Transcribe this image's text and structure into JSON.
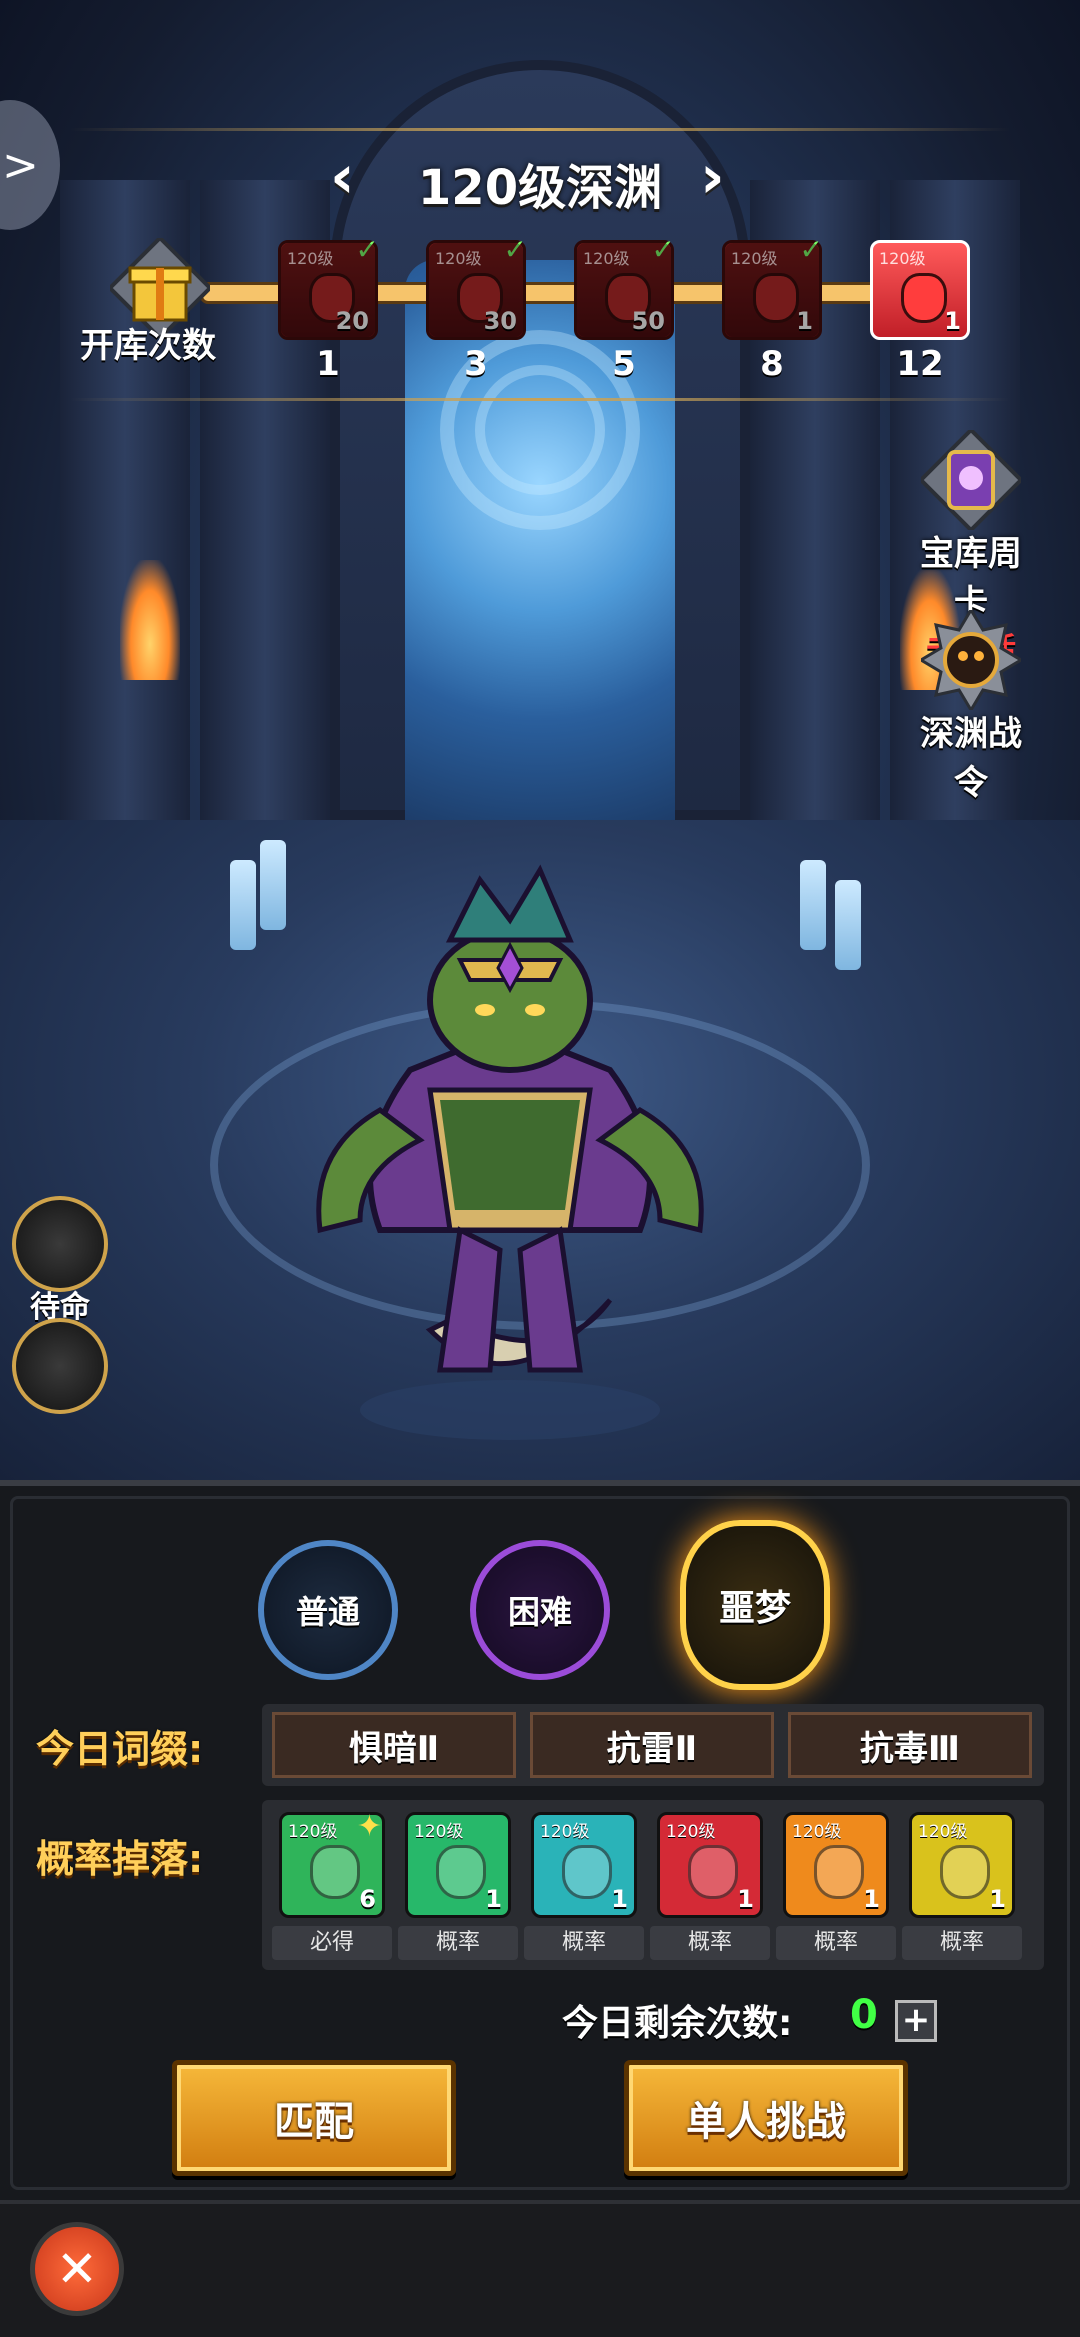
{
  "header": {
    "level_title": "120级深渊",
    "prev_arrow": "‹",
    "next_arrow": "›",
    "left_tab_arrow": ">"
  },
  "progress": {
    "label": "开库次数",
    "milestones": [
      {
        "tag": "120级",
        "count": "20",
        "step": "1",
        "claimed": true
      },
      {
        "tag": "120级",
        "count": "30",
        "step": "3",
        "claimed": true
      },
      {
        "tag": "120级",
        "count": "50",
        "step": "5",
        "claimed": true
      },
      {
        "tag": "120级",
        "count": "1",
        "step": "8",
        "claimed": true
      },
      {
        "tag": "120级",
        "count": "1",
        "step": "12",
        "claimed": false
      }
    ]
  },
  "right_buttons": {
    "weekly_card": {
      "label": "宝库周卡",
      "status": "未激活"
    },
    "battle_pass": {
      "label": "深渊战令"
    }
  },
  "left_buttons": {
    "standby": {
      "label": "待命"
    }
  },
  "difficulty": {
    "normal": "普通",
    "hard": "困难",
    "nightmare": "噩梦"
  },
  "affixes": {
    "label": "今日词缀:",
    "items": [
      "惧暗Ⅱ",
      "抗雷Ⅱ",
      "抗毒Ⅲ"
    ]
  },
  "drops": {
    "label": "概率掉落:",
    "items": [
      {
        "tag": "120级",
        "count": "6",
        "caption": "必得",
        "color": "#2fb45a"
      },
      {
        "tag": "120级",
        "count": "1",
        "caption": "概率",
        "color": "#27b86a"
      },
      {
        "tag": "120级",
        "count": "1",
        "caption": "概率",
        "color": "#2ab3b8"
      },
      {
        "tag": "120级",
        "count": "1",
        "caption": "概率",
        "color": "#d42a36"
      },
      {
        "tag": "120级",
        "count": "1",
        "caption": "概率",
        "color": "#ef8a1c"
      },
      {
        "tag": "120级",
        "count": "1",
        "caption": "概率",
        "color": "#d9c21c"
      }
    ]
  },
  "remaining": {
    "label": "今日剩余次数:",
    "value": "0",
    "plus": "+"
  },
  "actions": {
    "match": "匹配",
    "solo": "单人挑战"
  },
  "footer": {
    "close_icon": "✕"
  }
}
